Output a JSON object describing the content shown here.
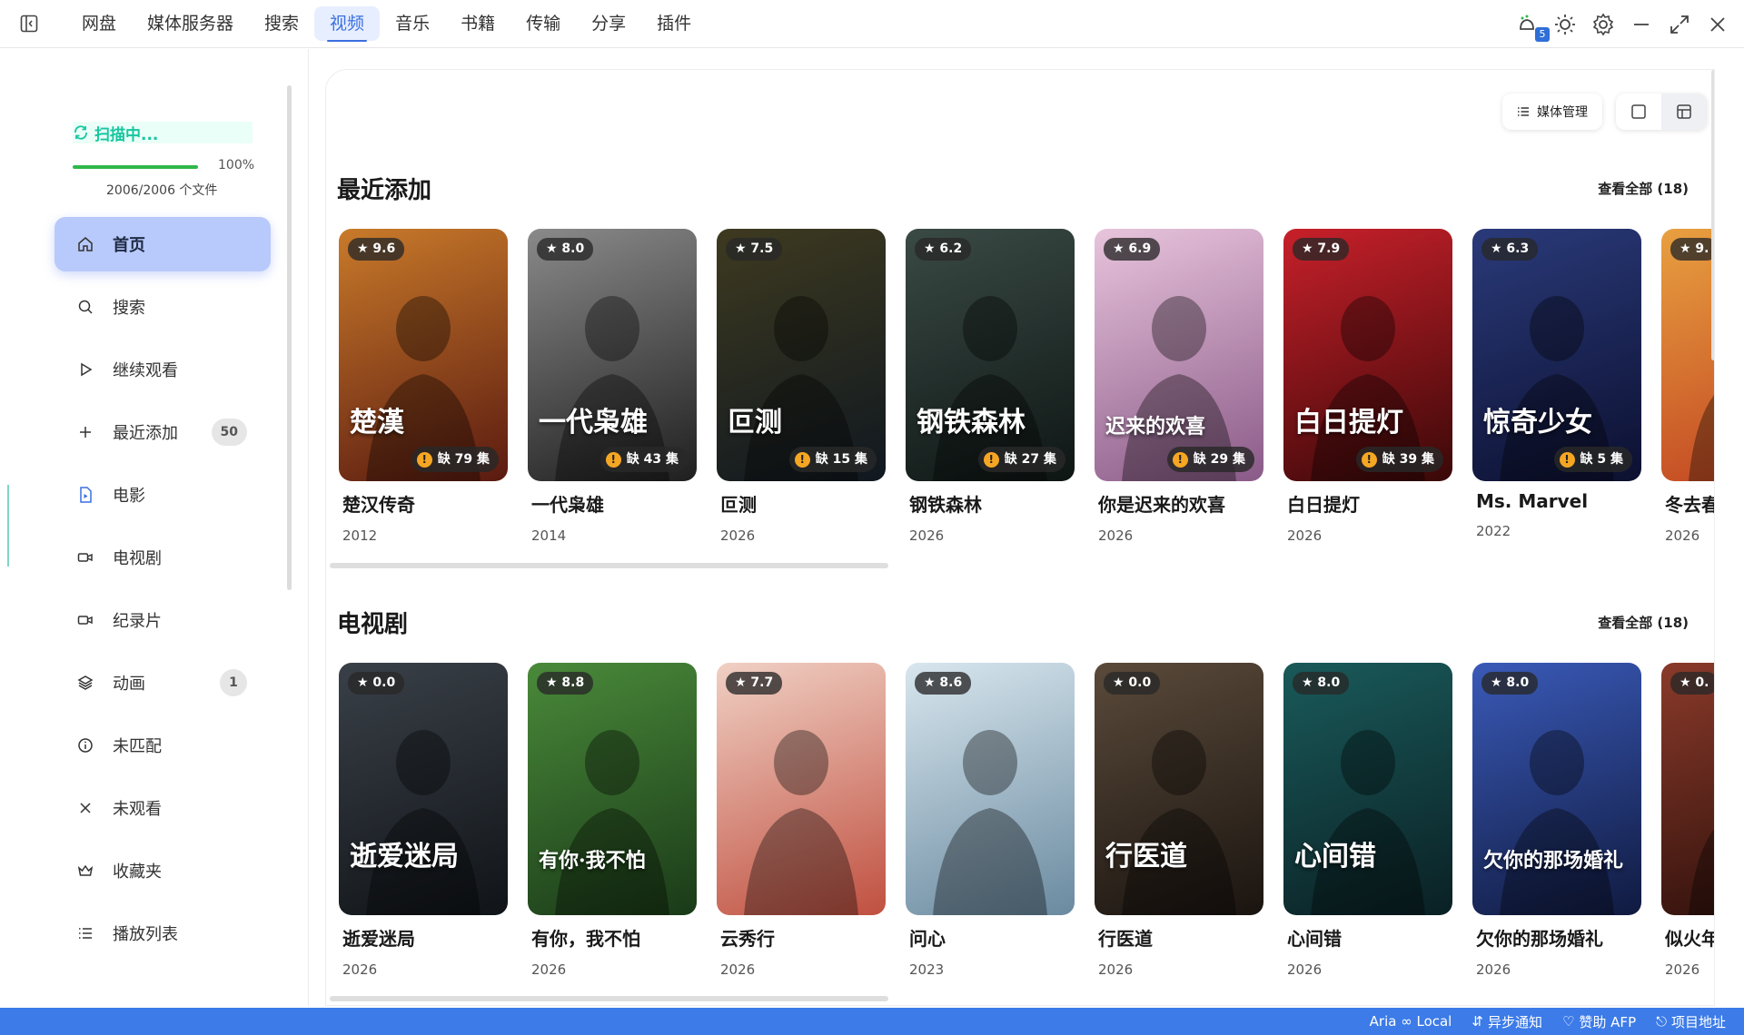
{
  "nav": {
    "tabs": [
      "网盘",
      "媒体服务器",
      "搜索",
      "视频",
      "音乐",
      "书籍",
      "传输",
      "分享",
      "插件"
    ],
    "active_tab": "视频",
    "notification_count": "5"
  },
  "sidebar": {
    "scan_status": "扫描中...",
    "progress_percent": "100%",
    "progress_fraction": 1.0,
    "file_count": "2006/2006 个文件",
    "items": [
      {
        "label": "首页",
        "icon": "home-icon",
        "active": true
      },
      {
        "label": "搜索",
        "icon": "search-icon"
      },
      {
        "label": "继续观看",
        "icon": "play-icon"
      },
      {
        "label": "最近添加",
        "icon": "plus-icon",
        "count": "50"
      },
      {
        "label": "电影",
        "icon": "file-video-icon"
      },
      {
        "label": "电视剧",
        "icon": "camera-icon"
      },
      {
        "label": "纪录片",
        "icon": "camera-icon"
      },
      {
        "label": "动画",
        "icon": "layers-icon",
        "count": "1"
      },
      {
        "label": "未匹配",
        "icon": "info-icon"
      },
      {
        "label": "未观看",
        "icon": "x-icon"
      },
      {
        "label": "收藏夹",
        "icon": "crown-icon"
      },
      {
        "label": "播放列表",
        "icon": "list-icon"
      }
    ]
  },
  "toolbar": {
    "media_manage": "媒体管理"
  },
  "sections": [
    {
      "title": "最近添加",
      "view_all": "查看全部 (18)",
      "cards": [
        {
          "title": "楚汉传奇",
          "year": "2012",
          "rating": "★ 9.6",
          "missing": "缺 79 集",
          "poster_text": "楚漢",
          "colors": [
            "#c97a2a",
            "#5a1a10"
          ]
        },
        {
          "title": "一代枭雄",
          "year": "2014",
          "rating": "★ 8.0",
          "missing": "缺 43 集",
          "poster_text": "一代枭雄",
          "colors": [
            "#8a8a8a",
            "#1f1f1f"
          ]
        },
        {
          "title": "叵测",
          "year": "2026",
          "rating": "★ 7.5",
          "missing": "缺 15 集",
          "poster_text": "叵测",
          "colors": [
            "#3e3a20",
            "#101820"
          ]
        },
        {
          "title": "钢铁森林",
          "year": "2026",
          "rating": "★ 6.2",
          "missing": "缺 27 集",
          "poster_text": "钢铁森林",
          "colors": [
            "#3a4a45",
            "#0e1614"
          ]
        },
        {
          "title": "你是迟来的欢喜",
          "year": "2026",
          "rating": "★ 6.9",
          "missing": "缺 29 集",
          "poster_text": "迟来的欢喜",
          "colors": [
            "#e8c4dc",
            "#8a5a88"
          ]
        },
        {
          "title": "白日提灯",
          "year": "2026",
          "rating": "★ 7.9",
          "missing": "缺 39 集",
          "poster_text": "白日提灯",
          "colors": [
            "#c8202a",
            "#3a0808"
          ]
        },
        {
          "title": "Ms. Marvel",
          "year": "2022",
          "rating": "★ 6.3",
          "missing": "缺 5 集",
          "poster_text": "惊奇少女",
          "colors": [
            "#2a3a7a",
            "#0c1030"
          ]
        },
        {
          "title": "冬去春来",
          "year": "2026",
          "rating": "★ 9.",
          "missing": "",
          "poster_text": "",
          "colors": [
            "#e8a040",
            "#c04020"
          ]
        }
      ]
    },
    {
      "title": "电视剧",
      "view_all": "查看全部 (18)",
      "cards": [
        {
          "title": "逝爱迷局",
          "year": "2026",
          "rating": "★ 0.0",
          "missing": "",
          "poster_text": "逝爱迷局",
          "colors": [
            "#3a4048",
            "#101418"
          ]
        },
        {
          "title": "有你，我不怕",
          "year": "2026",
          "rating": "★ 8.8",
          "missing": "",
          "poster_text": "有你·我不怕",
          "colors": [
            "#4a8a3a",
            "#1a3a18"
          ]
        },
        {
          "title": "云秀行",
          "year": "2026",
          "rating": "★ 7.7",
          "missing": "",
          "poster_text": "",
          "colors": [
            "#f0d0c4",
            "#c05040"
          ]
        },
        {
          "title": "问心",
          "year": "2023",
          "rating": "★ 8.6",
          "missing": "",
          "poster_text": "",
          "colors": [
            "#d8e6ee",
            "#6a8aa0"
          ]
        },
        {
          "title": "行医道",
          "year": "2026",
          "rating": "★ 0.0",
          "missing": "",
          "poster_text": "行医道",
          "colors": [
            "#5a4a3a",
            "#1a1410"
          ]
        },
        {
          "title": "心间错",
          "year": "2026",
          "rating": "★ 8.0",
          "missing": "",
          "poster_text": "心间错",
          "colors": [
            "#1a5a5a",
            "#0a2024"
          ]
        },
        {
          "title": "欠你的那场婚礼",
          "year": "2026",
          "rating": "★ 8.0",
          "missing": "",
          "poster_text": "欠你的那场婚礼",
          "colors": [
            "#3a5ab8",
            "#101a40"
          ]
        },
        {
          "title": "似火年华",
          "year": "2026",
          "rating": "★ 0.",
          "missing": "",
          "poster_text": "",
          "colors": [
            "#8a3a2a",
            "#2a0e0a"
          ]
        }
      ]
    }
  ],
  "statusbar": {
    "aria": "Aria ∞ Local",
    "sync": "异步通知",
    "sponsor": "赞助 AFP",
    "project": "项目地址"
  }
}
